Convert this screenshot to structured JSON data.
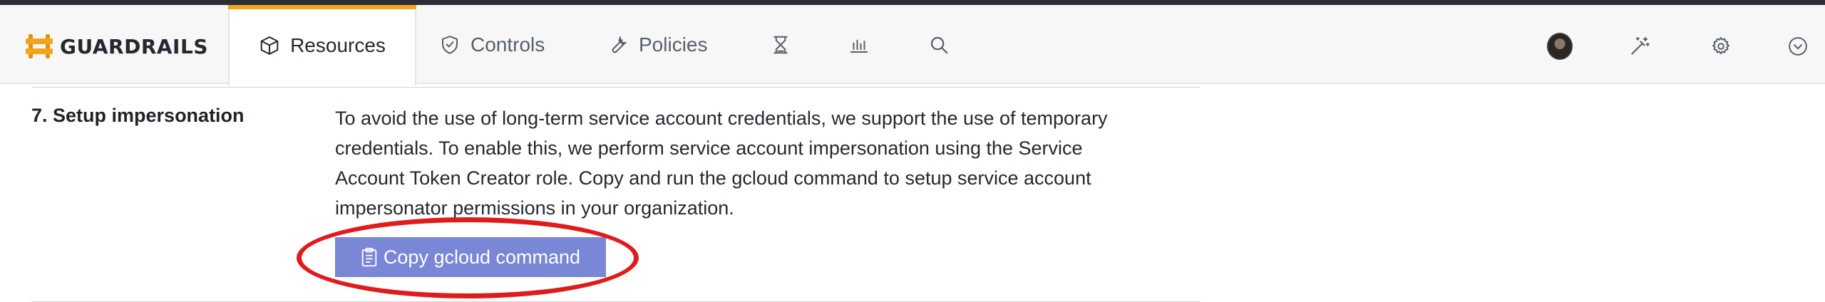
{
  "brand": {
    "name": "GUARDRAILS"
  },
  "nav": {
    "tabs": [
      {
        "label": "Resources",
        "icon": "cube-icon",
        "active": true
      },
      {
        "label": "Controls",
        "icon": "shield-check-icon",
        "active": false
      },
      {
        "label": "Policies",
        "icon": "wrench-icon",
        "active": false
      }
    ],
    "icon_tabs": [
      "hourglass-icon",
      "chart-bars-icon",
      "search-icon"
    ],
    "right_icons": [
      "avatar",
      "magic-wand-icon",
      "gear-icon",
      "chevron-down-icon"
    ]
  },
  "step": {
    "label": "7. Setup impersonation",
    "lines": [
      "To avoid the use of long-term service account credentials, we support the use of temporary",
      "credentials. To enable this, we perform service account impersonation using the Service",
      "Account Token Creator role. Copy and run the gcloud command to setup service account",
      "impersonator permissions in your organization."
    ],
    "button_label": "Copy gcloud command"
  },
  "colors": {
    "accent_tab": "#f2a41c",
    "button_bg": "#7a86d6",
    "callout": "#e01b1b",
    "brand_logo": "#f2a41c"
  }
}
